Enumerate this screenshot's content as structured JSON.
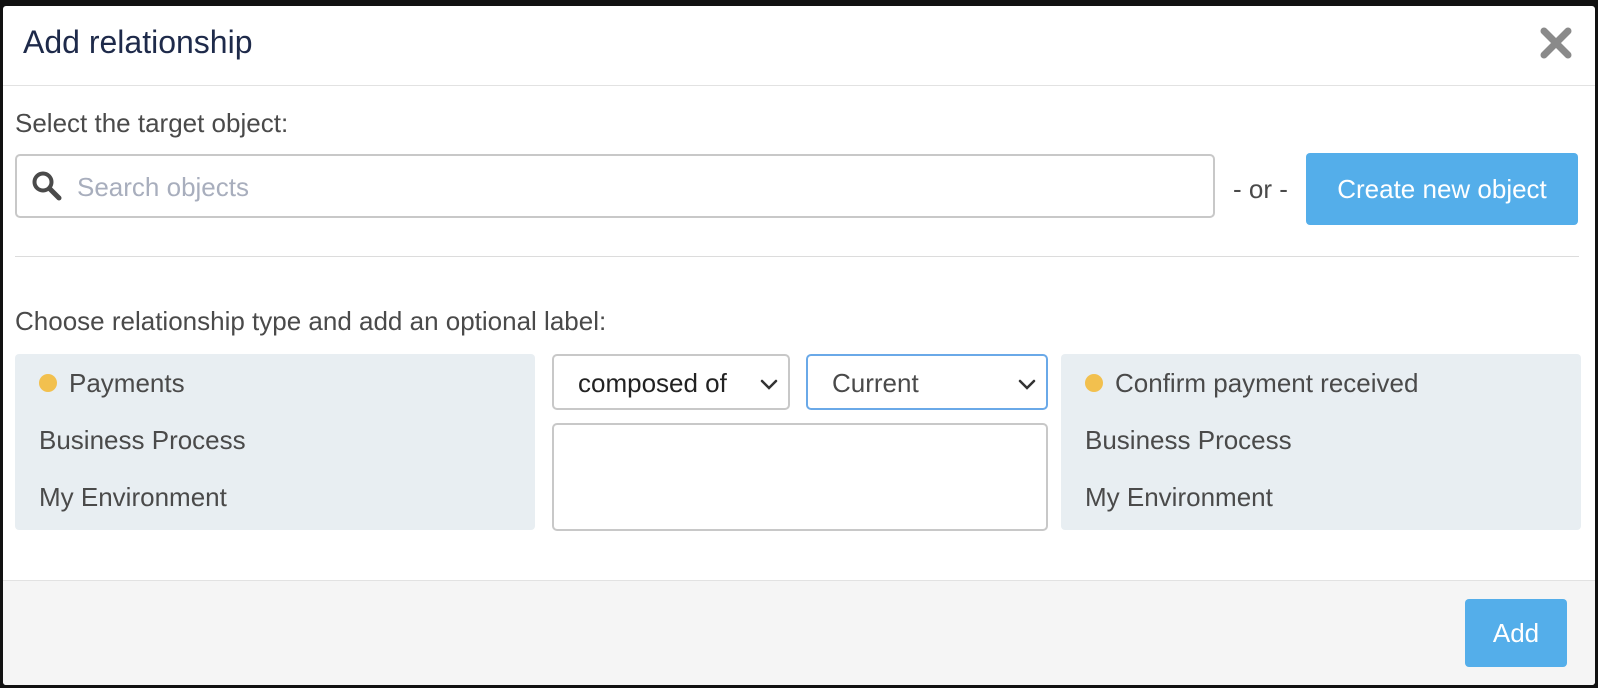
{
  "dialog": {
    "title": "Add relationship",
    "close_icon": "close-icon"
  },
  "target": {
    "label": "Select the target object:",
    "search_placeholder": "Search objects",
    "search_value": "",
    "or_text": "- or -",
    "create_button": "Create new object"
  },
  "relationship": {
    "label": "Choose relationship type and add an optional label:",
    "source": {
      "name": "Payments",
      "type": "Business Process",
      "environment": "My Environment"
    },
    "type_select": {
      "selected": "composed of"
    },
    "state_select": {
      "selected": "Current"
    },
    "optional_label_value": "",
    "target": {
      "name": "Confirm payment received",
      "type": "Business Process",
      "environment": "My Environment"
    }
  },
  "footer": {
    "add_button": "Add"
  },
  "colors": {
    "accent": "#54aeea",
    "status_dot": "#f2c04e",
    "card_bg": "#e8eef2",
    "title": "#1e2a4a"
  }
}
